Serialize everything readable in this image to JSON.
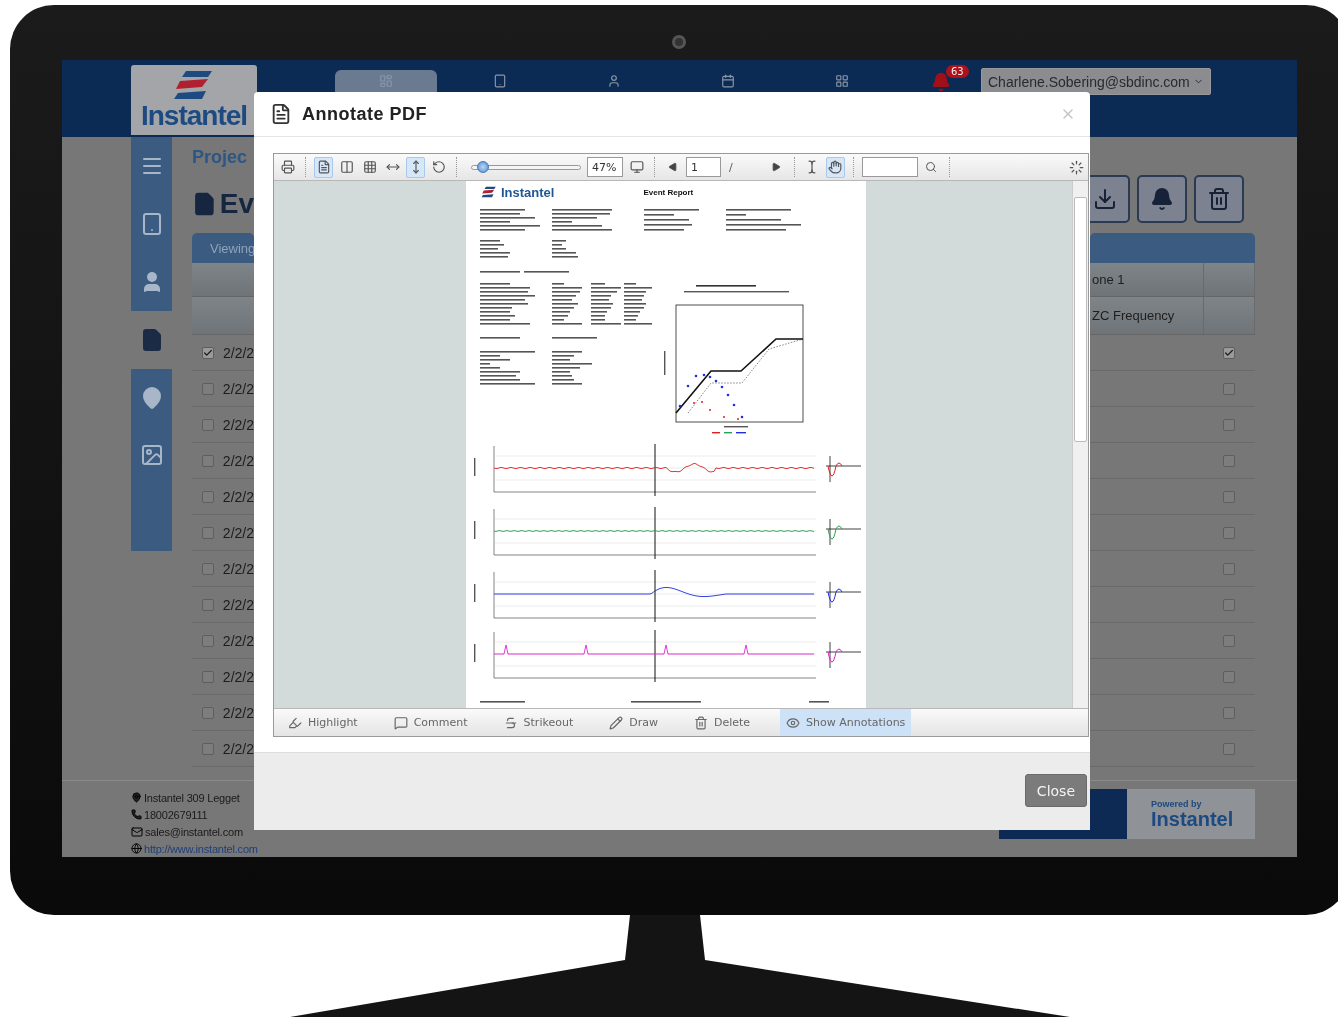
{
  "header": {
    "logo_text": "Instantel",
    "nav_tabs": [
      {
        "kind": "dashboard",
        "selected": true
      },
      {
        "kind": "tablet",
        "selected": false
      },
      {
        "kind": "user",
        "selected": false
      },
      {
        "kind": "calendar",
        "selected": false
      },
      {
        "kind": "grid",
        "selected": false
      }
    ],
    "notifications": {
      "count": "63"
    },
    "user_menu": {
      "label": "Charlene.Sobering@sbdinc.com"
    }
  },
  "sidebar": {
    "items": [
      {
        "kind": "menu",
        "selected": false
      },
      {
        "kind": "tablet",
        "selected": false
      },
      {
        "kind": "user",
        "selected": false
      },
      {
        "kind": "file",
        "selected": true
      },
      {
        "kind": "pin",
        "selected": false
      },
      {
        "kind": "image",
        "selected": false
      }
    ]
  },
  "page": {
    "breadcrumb": "Projec",
    "title": "Ev",
    "viewing_bar": "Viewing",
    "column_header": "one 1",
    "column_subheader": "ZC Frequency",
    "rows": [
      {
        "date": "2/2/2",
        "checked": true,
        "column_checked": true
      },
      {
        "date": "2/2/2",
        "checked": false,
        "column_checked": false
      },
      {
        "date": "2/2/2",
        "checked": false,
        "column_checked": false
      },
      {
        "date": "2/2/2",
        "checked": false,
        "column_checked": false
      },
      {
        "date": "2/2/2",
        "checked": false,
        "column_checked": false
      },
      {
        "date": "2/2/2",
        "checked": false,
        "column_checked": false
      },
      {
        "date": "2/2/2",
        "checked": false,
        "column_checked": false
      },
      {
        "date": "2/2/2",
        "checked": false,
        "column_checked": false
      },
      {
        "date": "2/2/2",
        "checked": false,
        "column_checked": false
      },
      {
        "date": "2/2/2",
        "checked": false,
        "column_checked": false
      },
      {
        "date": "2/2/2",
        "checked": false,
        "column_checked": false
      },
      {
        "date": "2/2/2",
        "checked": false,
        "column_checked": false
      }
    ]
  },
  "footer": {
    "address": "Instantel 309 Legget",
    "phone": "18002679111",
    "email": "sales@instantel.com",
    "website": "http://www.instantel.com",
    "powered_by": "Powered by",
    "brand": "Instantel"
  },
  "dialog": {
    "title": "Annotate PDF",
    "viewer": {
      "view_tools": [
        {
          "kind": "print",
          "selected": false
        },
        {
          "kind": "single-page",
          "selected": true
        },
        {
          "kind": "two-page",
          "selected": false
        },
        {
          "kind": "grid",
          "selected": false
        },
        {
          "kind": "fit-width",
          "selected": false
        },
        {
          "kind": "fit-height",
          "selected": true
        },
        {
          "kind": "rotate",
          "selected": false
        }
      ],
      "zoom": {
        "level": 0.1,
        "value": "47%"
      },
      "page_field": {
        "value": "1"
      },
      "page_separator": "/",
      "cursor_tools": [
        {
          "kind": "text-select",
          "selected": false
        },
        {
          "kind": "hand",
          "selected": true
        }
      ],
      "document": {
        "brand": "Instantel",
        "title": "Event Report"
      },
      "annotation_tools": [
        {
          "kind": "highlight",
          "label": "Highlight",
          "selected": false
        },
        {
          "kind": "comment",
          "label": "Comment",
          "selected": false
        },
        {
          "kind": "strikeout",
          "label": "Strikeout",
          "selected": false
        },
        {
          "kind": "draw",
          "label": "Draw",
          "selected": false
        },
        {
          "kind": "delete",
          "label": "Delete",
          "selected": false
        },
        {
          "kind": "show",
          "label": "Show Annotations",
          "selected": true
        }
      ]
    },
    "buttons": [
      {
        "label": "Close"
      }
    ]
  }
}
